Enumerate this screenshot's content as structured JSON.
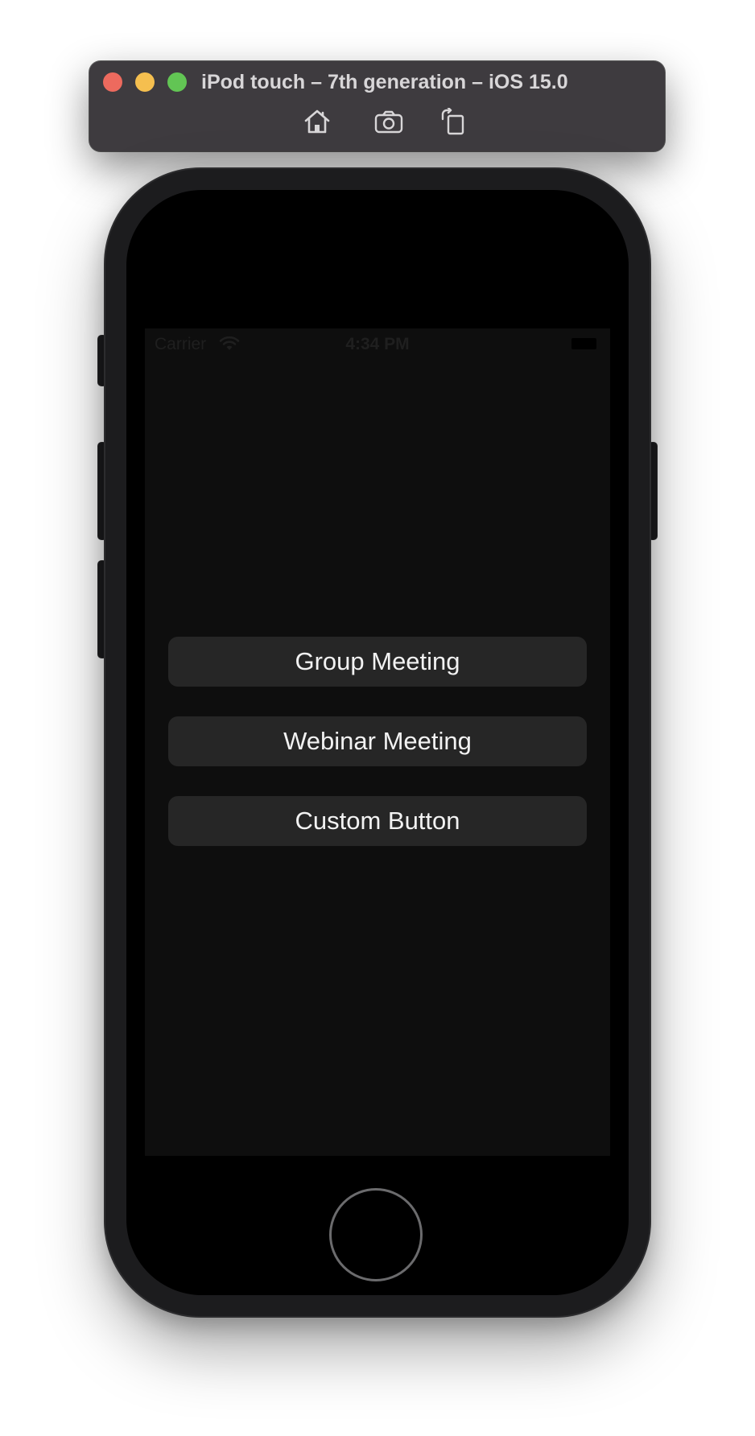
{
  "toolbar": {
    "title": "iPod touch – 7th generation – iOS 15.0",
    "icons": [
      "home-icon",
      "screenshot-icon",
      "rotate-icon"
    ]
  },
  "status_bar": {
    "carrier": "Carrier",
    "time": "4:34 PM"
  },
  "buttons": [
    {
      "label": "Group Meeting"
    },
    {
      "label": "Webinar Meeting"
    },
    {
      "label": "Custom Button"
    }
  ],
  "colors": {
    "toolbar_bg": "#3e3b3f",
    "screen_bg": "#0e0e0e",
    "button_bg": "#262626",
    "button_text": "#f2f2f2",
    "traffic_close": "#ed6a5e",
    "traffic_min": "#f5bf4f",
    "traffic_max": "#62c554"
  }
}
